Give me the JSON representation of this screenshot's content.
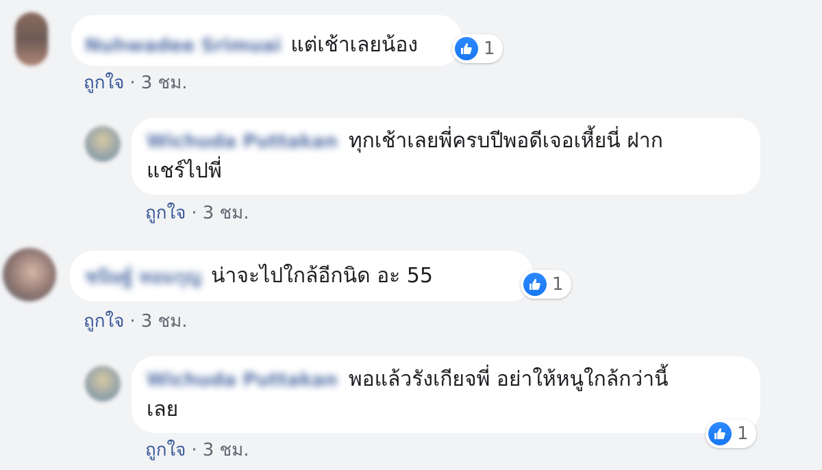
{
  "comments": [
    {
      "author": "Nuhwadee Srimuai",
      "text": "แต่เช้าเลยน้อง",
      "reactions": "1",
      "like_label": "ถูกใจ",
      "separator": "·",
      "time": "3 ชม."
    },
    {
      "author": "Wichuda Puttakan",
      "text_line1": "ทุกเช้าเลยพี่ครบปีพอดีเจอเหี้ยนี่ ฝาก",
      "text_line2": "แชร์ไปพี่",
      "like_label": "ถูกใจ",
      "separator": "·",
      "time": "3 ชม."
    },
    {
      "author": "ชนิษฐ์ หอมกุญ",
      "text": "น่าจะไปใกล้อีกนิด อะ 55",
      "reactions": "1",
      "like_label": "ถูกใจ",
      "separator": "·",
      "time": "3 ชม."
    },
    {
      "author": "Wichuda Puttakan",
      "text_line1": "พอแล้วรังเกียจพี่ อย่าให้หนูใกล้กว่านี้",
      "text_line2": "เลย",
      "reactions": "1",
      "like_label": "ถูกใจ",
      "separator": "·",
      "time": "3 ชม."
    }
  ],
  "colors": {
    "background": "#f2f3f5",
    "bubble": "#ffffff",
    "author": "#385898",
    "like_icon": "#1877f2"
  },
  "icons": {
    "reaction": "thumbs-up-icon"
  }
}
